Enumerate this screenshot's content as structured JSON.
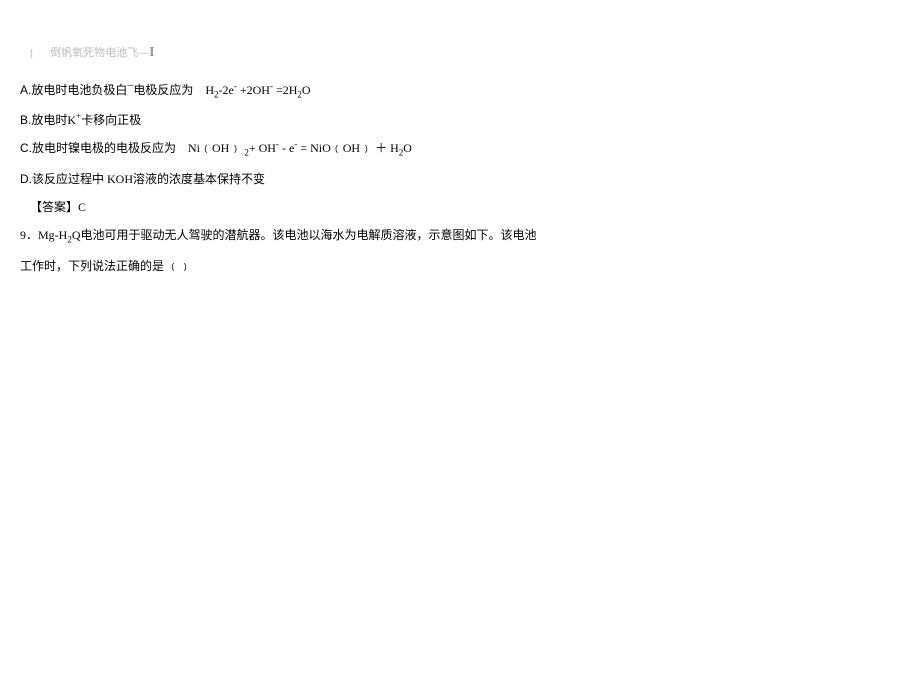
{
  "header": {
    "bracket_open": "[",
    "faint_text": "倒帆氧死物电池飞—",
    "big_i": "I"
  },
  "options": {
    "a": {
      "label": "A.",
      "text_1": "放电时电池负极白¯电极反应为",
      "formula": "H₂-2e⁻ +2OH⁻ =2H₂O"
    },
    "b": {
      "label": "B.",
      "text": "放电时K⁺卡移向正极"
    },
    "c": {
      "label": "C.",
      "text_1": "放电时镍电极的电极反应为",
      "formula": "Ni﹙OH﹚ ₂+ OH⁻ - e⁻ = NiO﹙OH﹚ ＋ H₂O"
    },
    "d": {
      "label": "D.",
      "text": "该反应过程中 KOH溶液的浓度基本保持不变"
    }
  },
  "answer": {
    "label": "【答案】",
    "value": "C"
  },
  "q9": {
    "label": "9．",
    "line1": "Mg-H₂Q电池可用于驱动无人驾驶的潜航器。该电池以海水为电解质溶液，示意图如下。该电池",
    "line2": "工作时，下列说法正确的是 ﹙﹚"
  }
}
